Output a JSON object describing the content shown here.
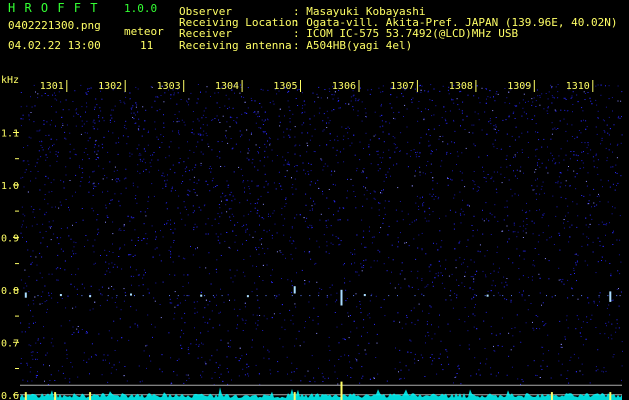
{
  "header": {
    "app_name": "H R O F F T",
    "version": "1.0.0",
    "filename": "0402221300.png",
    "timestamp": "04.02.22 13:00",
    "meteor_label": "meteor",
    "meteor_count": "11",
    "info_labels": [
      "Observer",
      "Receiving Location",
      "Receiver",
      "Receiving antenna"
    ],
    "info_values": [
      ": Masayuki Kobayashi",
      ": Ogata-vill. Akita-Pref. JAPAN (139.96E, 40.02N)",
      ": ICOM IC-575 53.7492(@LCD)MHz USB",
      ": A504HB(yagi 4el)"
    ]
  },
  "colors": {
    "header_text": "#ffff66",
    "app_name": "#33ff33",
    "axis_text": "#ffff66",
    "background": "#000000",
    "noise": "#2a2aff",
    "echo": "#aaddff",
    "spectrum": "#00ffff",
    "spike": "#ffff66",
    "guide_lines": "#aaaaaa"
  },
  "chart_data": {
    "type": "heatmap",
    "ylabel": "kHz",
    "x_ticks": [
      "1301",
      "1302",
      "1303",
      "1304",
      "1305",
      "1306",
      "1307",
      "1308",
      "1309",
      "1310"
    ],
    "y_ticks": [
      "1.1",
      "1.0",
      "0.9",
      "0.8",
      "0.7",
      "0.6"
    ],
    "xlim": [
      1300.2,
      1310.5
    ],
    "ylim": [
      0.59,
      1.2
    ],
    "echo_band_khz": 0.79,
    "meteor_echoes": [
      {
        "time": 1300.3,
        "freq": 0.79,
        "span": 0.01
      },
      {
        "time": 1300.9,
        "freq": 0.79,
        "span": 0.004
      },
      {
        "time": 1301.4,
        "freq": 0.788,
        "span": 0.004
      },
      {
        "time": 1302.1,
        "freq": 0.791,
        "span": 0.004
      },
      {
        "time": 1303.3,
        "freq": 0.789,
        "span": 0.004
      },
      {
        "time": 1304.1,
        "freq": 0.788,
        "span": 0.004
      },
      {
        "time": 1304.9,
        "freq": 0.8,
        "span": 0.014
      },
      {
        "time": 1305.7,
        "freq": 0.785,
        "span": 0.03
      },
      {
        "time": 1306.1,
        "freq": 0.79,
        "span": 0.004
      },
      {
        "time": 1308.2,
        "freq": 0.789,
        "span": 0.004
      },
      {
        "time": 1310.3,
        "freq": 0.787,
        "span": 0.02
      }
    ],
    "spectrum_spikes": [
      1300.3,
      1300.8,
      1301.4,
      1304.9,
      1305.7,
      1309.3,
      1310.3
    ]
  }
}
